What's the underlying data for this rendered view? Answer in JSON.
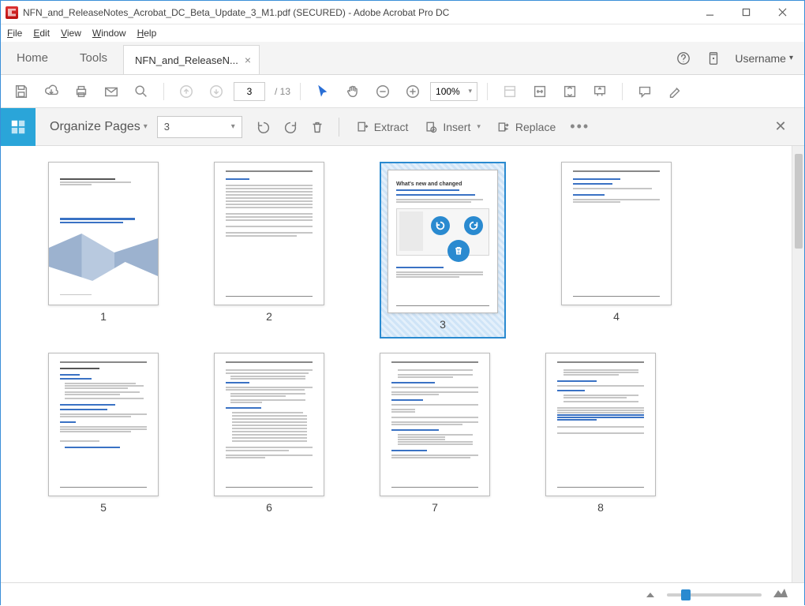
{
  "window": {
    "title": "NFN_and_ReleaseNotes_Acrobat_DC_Beta_Update_3_M1.pdf (SECURED) - Adobe Acrobat Pro DC"
  },
  "menu": {
    "file": "File",
    "edit": "Edit",
    "view": "View",
    "window": "Window",
    "help": "Help"
  },
  "header": {
    "home": "Home",
    "tools": "Tools",
    "doc_tab": "NFN_and_ReleaseN...",
    "username": "Username"
  },
  "toolbar": {
    "page_current": "3",
    "page_total": "/ 13",
    "zoom": "100%"
  },
  "organize": {
    "title": "Organize Pages",
    "page_field": "3",
    "extract": "Extract",
    "insert": "Insert",
    "replace": "Replace"
  },
  "thumbs": {
    "labels": [
      "1",
      "2",
      "3",
      "4",
      "5",
      "6",
      "7",
      "8"
    ],
    "selected_index": 2,
    "page3_title": "What's new and changed"
  }
}
